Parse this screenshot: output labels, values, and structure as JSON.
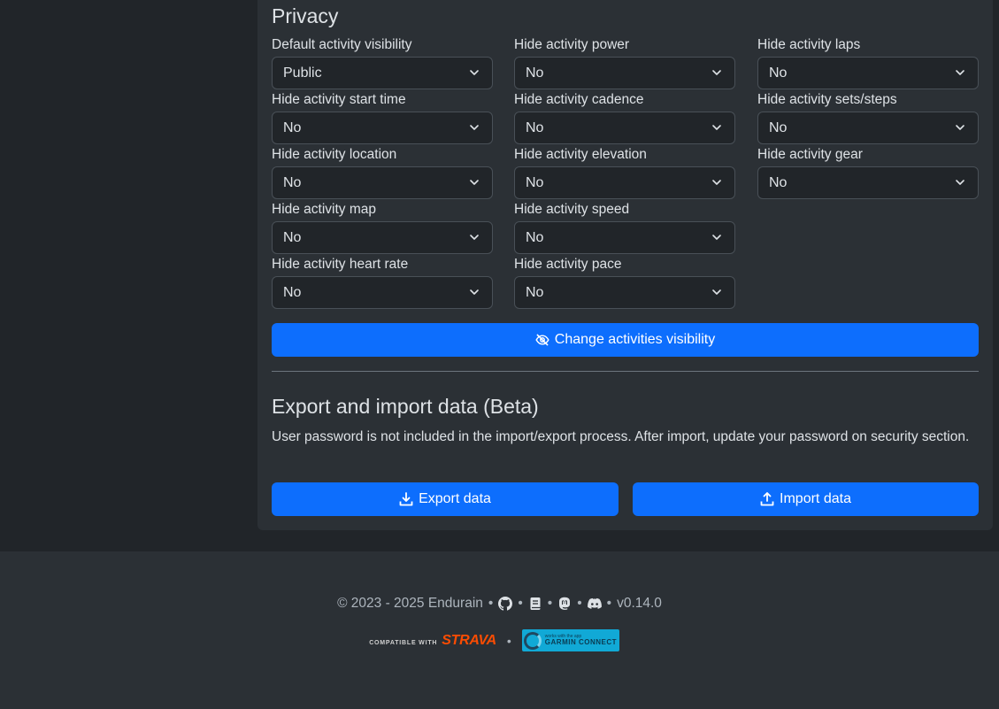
{
  "privacy": {
    "title": "Privacy",
    "fields": [
      {
        "label": "Default activity visibility",
        "value": "Public"
      },
      {
        "label": "Hide activity start time",
        "value": "No"
      },
      {
        "label": "Hide activity location",
        "value": "No"
      },
      {
        "label": "Hide activity map",
        "value": "No"
      },
      {
        "label": "Hide activity heart rate",
        "value": "No"
      },
      {
        "label": "Hide activity power",
        "value": "No"
      },
      {
        "label": "Hide activity cadence",
        "value": "No"
      },
      {
        "label": "Hide activity elevation",
        "value": "No"
      },
      {
        "label": "Hide activity speed",
        "value": "No"
      },
      {
        "label": "Hide activity pace",
        "value": "No"
      },
      {
        "label": "Hide activity laps",
        "value": "No"
      },
      {
        "label": "Hide activity sets/steps",
        "value": "No"
      },
      {
        "label": "Hide activity gear",
        "value": "No"
      }
    ],
    "change_visibility_label": "Change activities visibility"
  },
  "export_import": {
    "title": "Export and import data (Beta)",
    "note": "User password is not included in the import/export process. After import, update your password on security section.",
    "export_label": "Export data",
    "import_label": "Import data"
  },
  "footer": {
    "copyright": "© 2023 - 2025 Endurain",
    "separator": "•",
    "version": "v0.14.0",
    "icons": [
      "github-icon",
      "book-icon",
      "mastodon-icon",
      "discord-icon"
    ],
    "strava_compat": "COMPATIBLE WITH",
    "strava_word": "STRAVA",
    "garmin_small": "works with the app",
    "garmin_big": "GARMIN CONNECT"
  },
  "colors": {
    "background": "#212529",
    "card": "#2b3035",
    "primary": "#0d6efd",
    "strava": "#fc4c02",
    "garmin": "#11a9d6"
  }
}
